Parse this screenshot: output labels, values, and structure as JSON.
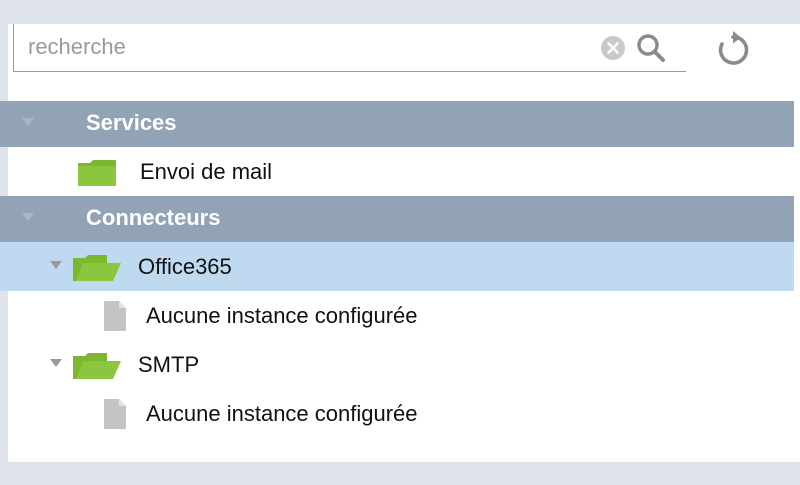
{
  "search": {
    "placeholder": "recherche",
    "value": ""
  },
  "icons": {
    "clear": "clear-circle-x-icon",
    "search": "magnifier-icon",
    "refresh": "refresh-circular-arrow-icon",
    "folder": "green-folder-icon",
    "document": "gray-document-icon"
  },
  "colors": {
    "section_header_bg": "#93a3b6",
    "selected_row_bg": "#bfdaf0",
    "folder_green": "#7cb82f",
    "outer_bg": "#dfe4ec"
  },
  "tree": {
    "services": {
      "label": "Services",
      "items": [
        {
          "label": "Envoi de mail"
        }
      ]
    },
    "connecteurs": {
      "label": "Connecteurs",
      "items": [
        {
          "label": "Office365",
          "selected": true,
          "children": [
            {
              "label": "Aucune instance configurée"
            }
          ]
        },
        {
          "label": "SMTP",
          "selected": false,
          "children": [
            {
              "label": "Aucune instance configurée"
            }
          ]
        }
      ]
    }
  }
}
